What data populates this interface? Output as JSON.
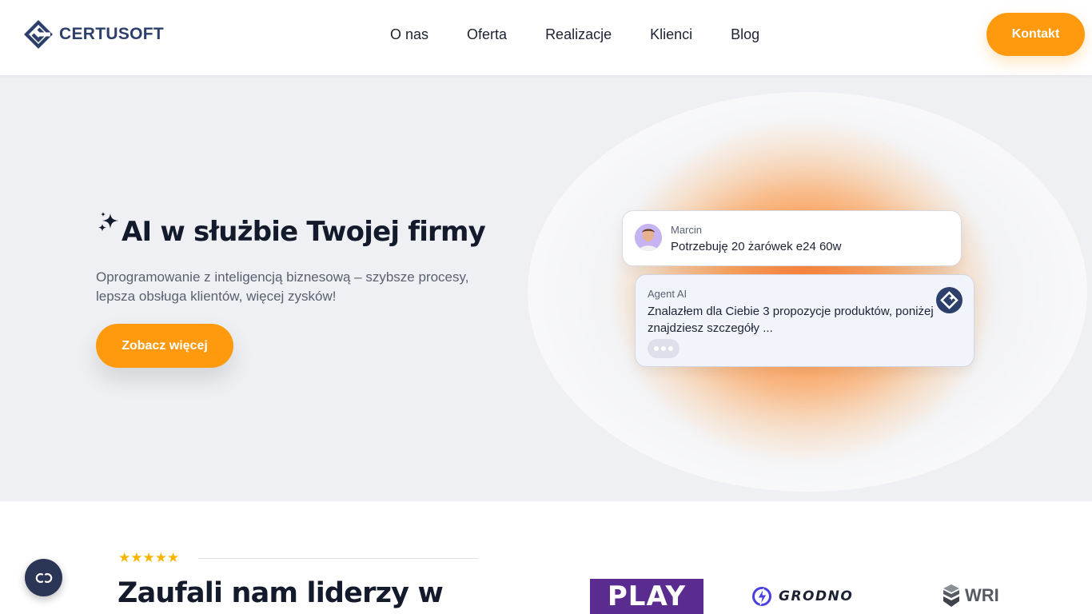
{
  "brand": {
    "name": "CERTUSOFT",
    "color": "#2d3f6b",
    "accent": "#ff9a0e"
  },
  "nav": {
    "items": [
      {
        "label": "O nas"
      },
      {
        "label": "Oferta"
      },
      {
        "label": "Realizacje"
      },
      {
        "label": "Klienci"
      },
      {
        "label": "Blog"
      }
    ],
    "contact_label": "Kontakt"
  },
  "hero": {
    "title": "AI w służbie Twojej firmy",
    "subtitle": "Oprogramowanie z inteligencją biznesową – szybsze procesy, lepsza obsługa klientów, więcej zysków!",
    "cta_label": "Zobacz więcej",
    "icon": "sparkle-icon"
  },
  "chat": {
    "user": {
      "name": "Marcin",
      "message": "Potrzebuję 20 żarówek e24 60w"
    },
    "agent": {
      "name": "Agent AI",
      "message": "Znalazłem dla Ciebie 3 propozycje produktów, poniżej znajdziesz szczegóły ..."
    }
  },
  "trust": {
    "stars": "★★★★★",
    "rating": 5,
    "title": "Zaufali nam liderzy w",
    "logos": {
      "play": "PLAY",
      "grodno": "GRODNO",
      "wri": "WRI"
    }
  },
  "fab": {
    "icon": "cookie-settings-icon"
  }
}
